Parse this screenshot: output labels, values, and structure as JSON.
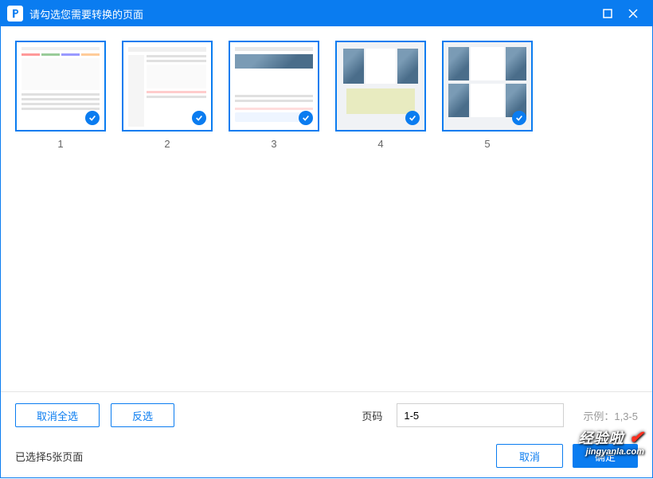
{
  "titlebar": {
    "title": "请勾选您需要转换的页面"
  },
  "thumbs": [
    {
      "label": "1"
    },
    {
      "label": "2"
    },
    {
      "label": "3"
    },
    {
      "label": "4"
    },
    {
      "label": "5"
    }
  ],
  "footer": {
    "deselect_all": "取消全选",
    "invert": "反选",
    "page_label": "页码",
    "page_value": "1-5",
    "page_example": "示例：1,3-5",
    "status": "已选择5张页面",
    "cancel": "取消",
    "confirm": "确定"
  },
  "watermark": {
    "top": "经验啦",
    "url": "jingyanla.com"
  }
}
